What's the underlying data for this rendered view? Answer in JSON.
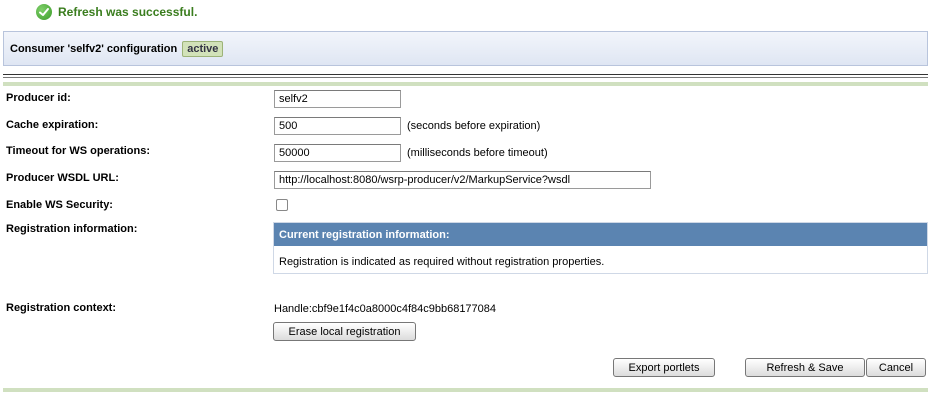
{
  "status": {
    "message": "Refresh was successful."
  },
  "consumer": {
    "title": "Consumer 'selfv2' configuration",
    "badge": "active"
  },
  "form": {
    "producer_id": {
      "label": "Producer id:",
      "value": "selfv2"
    },
    "cache_expiration": {
      "label": "Cache expiration:",
      "value": "500",
      "hint": "(seconds before expiration)"
    },
    "timeout": {
      "label": "Timeout for WS operations:",
      "value": "50000",
      "hint": "(milliseconds before timeout)"
    },
    "wsdl_url": {
      "label": "Producer WSDL URL:",
      "value": "http://localhost:8080/wsrp-producer/v2/MarkupService?wsdl"
    },
    "ws_security": {
      "label": "Enable WS Security:",
      "checked": false
    },
    "registration_info": {
      "label": "Registration information:",
      "panel_title": "Current registration information:",
      "panel_text": "Registration is indicated as required without registration properties."
    },
    "registration_context": {
      "label": "Registration context:",
      "handle": "Handle:cbf9e1f4c0a8000c4f84c9bb68177084",
      "erase_button": "Erase local registration"
    }
  },
  "actions": {
    "export": "Export portlets",
    "refresh_save": "Refresh & Save",
    "cancel": "Cancel"
  }
}
